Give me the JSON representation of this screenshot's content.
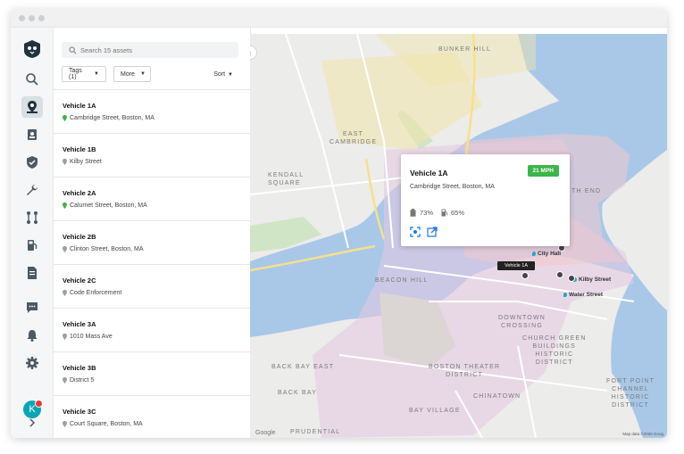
{
  "search": {
    "placeholder": "Search 15 assets"
  },
  "filters": {
    "tags_label": "Tags (1)",
    "more_label": "More",
    "sort_label": "Sort"
  },
  "assets": [
    {
      "name": "Vehicle 1A",
      "location": "Cambridge Street, Boston, MA",
      "pin_color": "#3cb54a"
    },
    {
      "name": "Vehicle 1B",
      "location": "Kilby Street",
      "pin_color": "#9aa0a6"
    },
    {
      "name": "Vehicle 2A",
      "location": "Calumet Street, Boston, MA",
      "pin_color": "#3cb54a"
    },
    {
      "name": "Vehicle 2B",
      "location": "Clinton Street, Boston, MA",
      "pin_color": "#9aa0a6"
    },
    {
      "name": "Vehicle 2C",
      "location": "Code Enforcement",
      "pin_color": "#9aa0a6"
    },
    {
      "name": "Vehicle 3A",
      "location": "1010 Mass Ave",
      "pin_color": "#9aa0a6"
    },
    {
      "name": "Vehicle 3B",
      "location": "District 5",
      "pin_color": "#9aa0a6"
    },
    {
      "name": "Vehicle 3C",
      "location": "Court Square, Boston, MA",
      "pin_color": "#9aa0a6"
    }
  ],
  "user": {
    "initial": "K"
  },
  "popup": {
    "title": "Vehicle 1A",
    "speed": "21 MPH",
    "address": "Cambridge Street, Boston, MA",
    "battery": "73%",
    "fuel": "65%"
  },
  "map": {
    "marker_label": "Vehicle 1A",
    "labels": {
      "bunker_hill": "BUNKER HILL",
      "east_cambridge": "EAST\nCAMBRIDGE",
      "kendall_square": "KENDALL\nSQUARE",
      "north_end": "TH END",
      "beacon_hill": "BEACON HILL",
      "downtown_crossing": "DOWNTOWN\nCROSSING",
      "church_green": "CHURCH GREEN\nBUILDINGS\nHISTORIC\nDISTRICT",
      "back_bay_east": "BACK BAY EAST",
      "boston_theater": "BOSTON THEATER\nDISTRICT",
      "back_bay": "BACK BAY",
      "chinatown": "CHINATOWN",
      "bay_village": "BAY VILLAGE",
      "fort_point": "FORT POINT\nCHANNEL\nHISTORIC\nDISTRICT",
      "prudential": "PRUDENTIAL"
    },
    "pois": {
      "city_hall": "City Hall",
      "kilby_street": "Kilby Street",
      "water_street": "Water Street"
    },
    "google": "Google",
    "attribution": "Map data ©2020 Goog"
  }
}
